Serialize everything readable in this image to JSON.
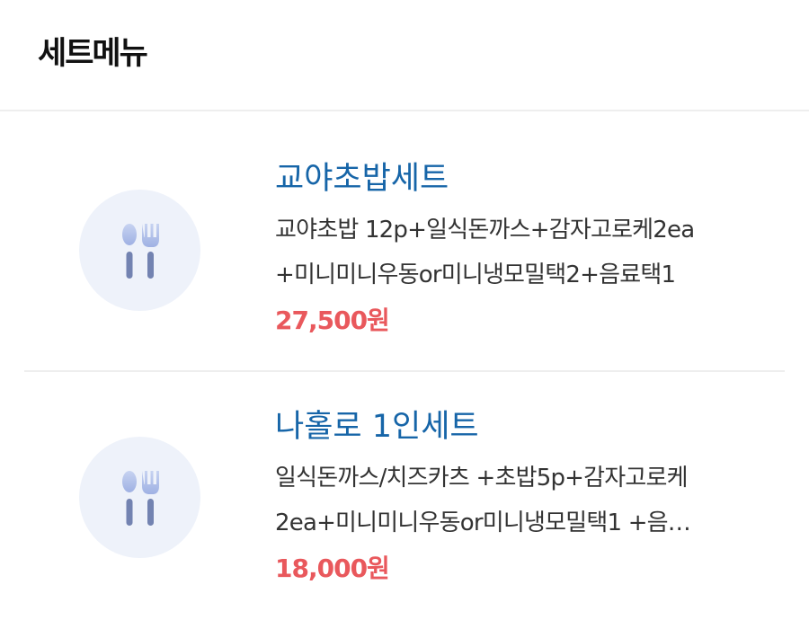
{
  "header": {
    "title": "세트메뉴"
  },
  "set_menu": {
    "items": [
      {
        "name": "교야초밥세트",
        "description_line1": "교야초밥 12p+일식돈까스+감자고로케2ea",
        "description_line2": "+미니미니우동or미니냉모밀택2+음료택1",
        "price": "27,500원",
        "icon": "utensils-icon"
      },
      {
        "name": "나홀로 1인세트",
        "description_line1": "일식돈까스/치즈카츠 +초밥5p+감자고로케",
        "description_line2": "2ea+미니미니우동or미니냉모밀택1 +음…",
        "price": "18,000원",
        "icon": "utensils-icon"
      }
    ]
  },
  "colors": {
    "name": "#1665a8",
    "price": "#e9585c",
    "icon_bg": "#eef2fa"
  }
}
